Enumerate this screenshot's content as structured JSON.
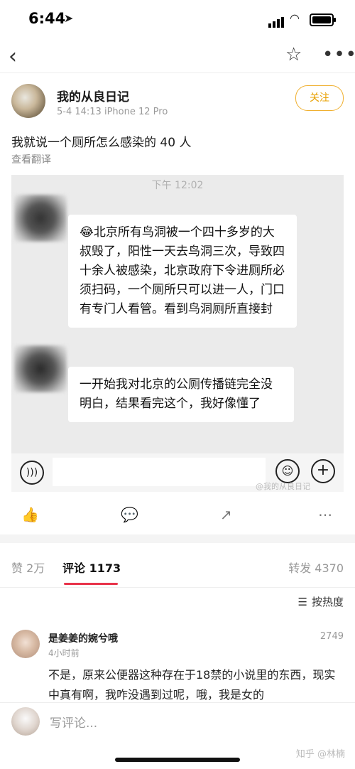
{
  "status_bar": {
    "time": "6:44",
    "location_glyph": "➤"
  },
  "nav": {
    "back_glyph": "‹",
    "star_glyph": "☆",
    "more_glyph": "•••"
  },
  "post": {
    "author": "我的从良日记",
    "meta": "5-4 14:13   iPhone 12 Pro",
    "follow_label": "关注",
    "text": "我就说一个厕所怎么感染的 40 人",
    "translate_label": "查看翻译"
  },
  "screenshot": {
    "time": "下午 12:02",
    "bubble1": "😂北京所有鸟洞被一个四十多岁的大叔毁了，阳性一天去鸟洞三次，导致四十余人被感染，北京政府下令进厕所必须扫码，一个厕所只可以进一人，门口有专门人看管。看到鸟洞厕所直接封",
    "bubble2": "一开始我对北京的公厕传播链完全没明白，结果看完这个，我好像懂了",
    "watermark": "@我的从良日记"
  },
  "actions": {
    "like": "👍",
    "comment": "💬",
    "share": "↗",
    "more": "⋯"
  },
  "tabs": {
    "likes": "赞 2万",
    "comments": "评论 1173",
    "reposts": "转发 4370"
  },
  "sort_label": "按热度",
  "comment": {
    "author": "是姜姜的婉兮哦",
    "time": "4小时前",
    "likes": "2749",
    "text": "不是，原来公便器这种存在于18禁的小说里的东西，现实中真有啊，我咋没遇到过呢，哦，我是女的"
  },
  "composer_placeholder": "写评论...",
  "footer_watermark": "知乎 @林楠"
}
